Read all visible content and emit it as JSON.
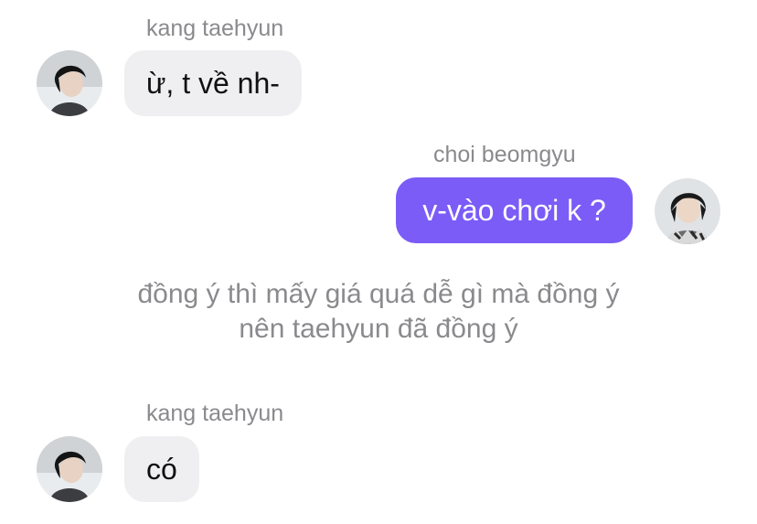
{
  "colors": {
    "outgoing_bubble": "#7b5cf7",
    "incoming_bubble": "#efeff1",
    "name_text": "#8a8a8e",
    "narration_text": "#8a8a8e"
  },
  "messages": [
    {
      "sender": "kang taehyun",
      "text": "ừ, t về nh-",
      "direction": "incoming",
      "avatar_icon": "user-avatar-icon"
    },
    {
      "sender": "choi beomgyu",
      "text": "v-vào chơi k ?",
      "direction": "outgoing",
      "avatar_icon": "user-avatar-icon"
    },
    {
      "sender": "kang taehyun",
      "text": "có",
      "direction": "incoming",
      "avatar_icon": "user-avatar-icon"
    }
  ],
  "narration": {
    "line1": "đồng ý thì mấy giá quá dễ gì mà đồng ý",
    "line2": "nên taehyun đã đồng ý"
  }
}
